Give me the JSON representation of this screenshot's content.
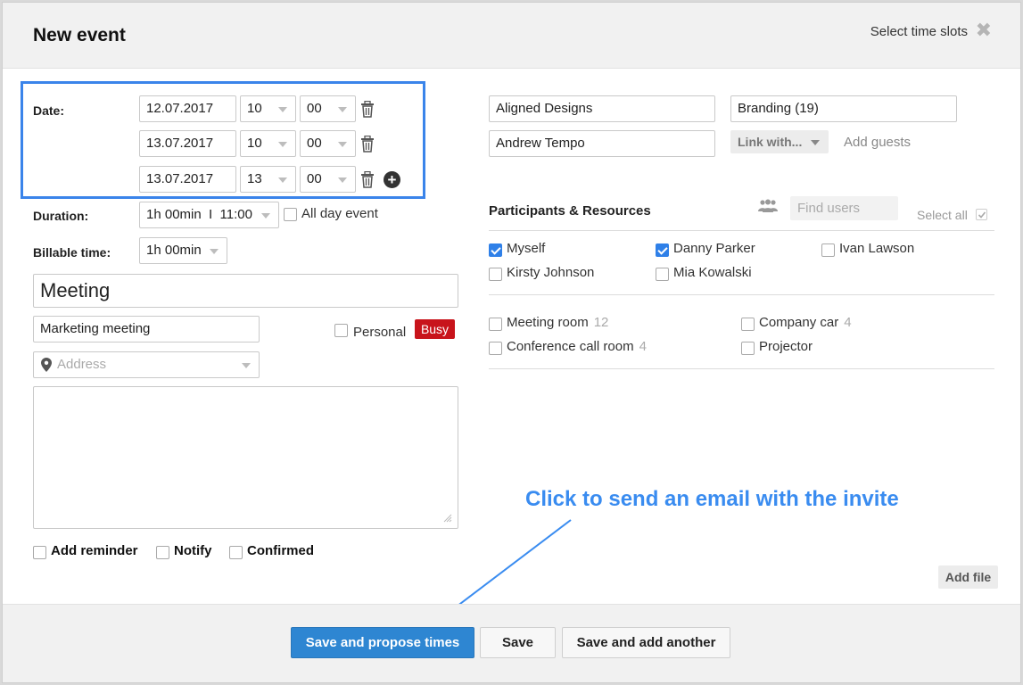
{
  "header": {
    "title": "New event",
    "select_slots": "Select time slots",
    "close_icon": "close-icon"
  },
  "date_section": {
    "label": "Date:",
    "rows": [
      {
        "date": "12.07.2017",
        "hour": "10",
        "minute": "00"
      },
      {
        "date": "13.07.2017",
        "hour": "10",
        "minute": "00"
      },
      {
        "date": "13.07.2017",
        "hour": "13",
        "minute": "00"
      }
    ]
  },
  "duration": {
    "label": "Duration:",
    "value": "1h 00min  I  11:00",
    "all_day": "All day event"
  },
  "billable": {
    "label": "Billable time:",
    "value": "1h 00min"
  },
  "event_title": "Meeting",
  "event_type": "Marketing meeting",
  "personal": "Personal",
  "busy": "Busy",
  "address_placeholder": "Address",
  "checkboxes_bottom": {
    "reminder": "Add reminder",
    "notify": "Notify",
    "confirmed": "Confirmed"
  },
  "right": {
    "company": "Aligned Designs",
    "project": "Branding (19)",
    "contact": "Andrew Tempo",
    "link_with": "Link with...",
    "add_guests": "Add guests"
  },
  "participants": {
    "title": "Participants & Resources",
    "find_placeholder": "Find users",
    "select_all": "Select all",
    "people": [
      {
        "name": "Myself",
        "checked": true
      },
      {
        "name": "Danny Parker",
        "checked": true
      },
      {
        "name": "Ivan Lawson",
        "checked": false
      },
      {
        "name": "Kirsty Johnson",
        "checked": false
      },
      {
        "name": "Mia Kowalski",
        "checked": false
      }
    ],
    "resources": [
      {
        "name": "Meeting room",
        "count": "12"
      },
      {
        "name": "Company car",
        "count": "4"
      },
      {
        "name": "Conference call room",
        "count": "4"
      },
      {
        "name": "Projector",
        "count": ""
      }
    ]
  },
  "add_file": "Add file",
  "annotation": "Click to send an email with the invite",
  "footer": {
    "primary": "Save and propose times",
    "save": "Save",
    "save_another": "Save and add another"
  },
  "colors": {
    "accent": "#2e86d2",
    "annotation": "#3a8cf0",
    "busy": "#c8141b"
  }
}
